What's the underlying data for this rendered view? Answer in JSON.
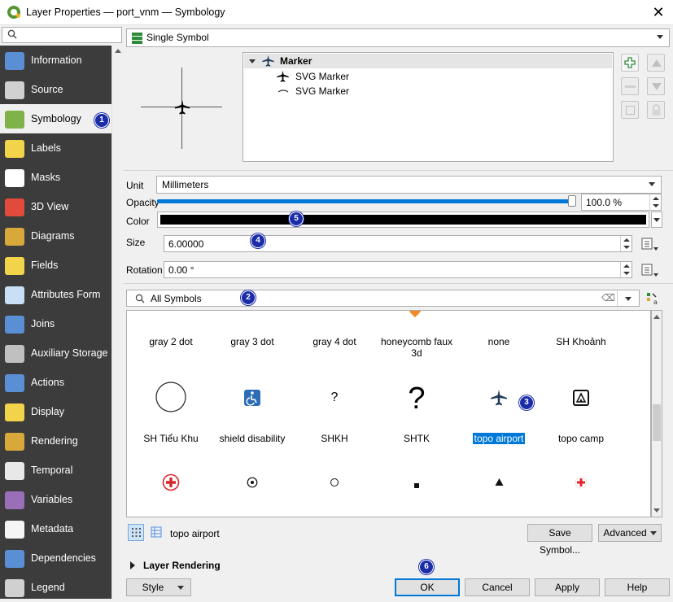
{
  "window": {
    "title": "Layer Properties — port_vnm — Symbology",
    "close_glyph": "✕"
  },
  "sidebar": {
    "search_icon": "magnifier-icon",
    "items": [
      {
        "label": "Information",
        "icon": "information-icon",
        "color": "#5a8fd6"
      },
      {
        "label": "Source",
        "icon": "source-gear-icon",
        "color": "#d0d0d0"
      },
      {
        "label": "Symbology",
        "icon": "symbology-brush-icon",
        "color": "#7fb34a"
      },
      {
        "label": "Labels",
        "icon": "labels-abc-icon",
        "color": "#f2d44b"
      },
      {
        "label": "Masks",
        "icon": "masks-abc-icon",
        "color": "#ffffff"
      },
      {
        "label": "3D View",
        "icon": "cube-3d-icon",
        "color": "#e24b3b"
      },
      {
        "label": "Diagrams",
        "icon": "diagrams-icon",
        "color": "#d9a83a"
      },
      {
        "label": "Fields",
        "icon": "fields-icon",
        "color": "#f2d44b"
      },
      {
        "label": "Attributes Form",
        "icon": "attributes-form-icon",
        "color": "#c9dff5"
      },
      {
        "label": "Joins",
        "icon": "joins-icon",
        "color": "#5a8fd6"
      },
      {
        "label": "Auxiliary Storage",
        "icon": "auxiliary-storage-icon",
        "color": "#c0c0c0"
      },
      {
        "label": "Actions",
        "icon": "actions-gear-icon",
        "color": "#5a8fd6"
      },
      {
        "label": "Display",
        "icon": "display-speech-icon",
        "color": "#f2d44b"
      },
      {
        "label": "Rendering",
        "icon": "rendering-brush-icon",
        "color": "#d9a83a"
      },
      {
        "label": "Temporal",
        "icon": "temporal-clock-icon",
        "color": "#e8e8e8"
      },
      {
        "label": "Variables",
        "icon": "variables-icon",
        "color": "#9b6fb8"
      },
      {
        "label": "Metadata",
        "icon": "metadata-icon",
        "color": "#f5f5f5"
      },
      {
        "label": "Dependencies",
        "icon": "dependencies-icon",
        "color": "#5a8fd6"
      },
      {
        "label": "Legend",
        "icon": "legend-icon",
        "color": "#d0d0d0"
      }
    ],
    "active_index": 2
  },
  "renderer": {
    "selected": "Single Symbol",
    "icon": "single-symbol-icon"
  },
  "symbol_tree": {
    "root": "Marker",
    "layers": [
      "SVG Marker",
      "SVG Marker"
    ]
  },
  "unit": {
    "label": "Unit",
    "value": "Millimeters"
  },
  "opacity": {
    "label": "Opacity",
    "value": "100.0 %",
    "fraction": 1.0
  },
  "color": {
    "label": "Color",
    "value": "#000000"
  },
  "size": {
    "label": "Size",
    "value": "6.00000"
  },
  "rotation": {
    "label": "Rotation",
    "value": "0.00 °"
  },
  "symbol_search": {
    "value": "All Symbols",
    "clear_glyph": "⌫"
  },
  "symbols_row1": [
    {
      "name": "gray 2 dot"
    },
    {
      "name": "gray 3 dot"
    },
    {
      "name": "gray 4 dot"
    },
    {
      "name": "honeycomb faux 3d"
    },
    {
      "name": "none"
    },
    {
      "name": "SH Khoảnh"
    }
  ],
  "symbols_row2": [
    {
      "name": "SH Tiểu Khu",
      "icon": "circle-outline-icon"
    },
    {
      "name": "shield disability",
      "icon": "wheelchair-icon"
    },
    {
      "name": "SHKH",
      "icon": "question-small-icon",
      "glyph": "?"
    },
    {
      "name": "SHTK",
      "icon": "question-large-icon",
      "glyph": "?"
    },
    {
      "name": "topo airport",
      "icon": "airplane-icon",
      "selected": true
    },
    {
      "name": "topo camp",
      "icon": "tent-icon"
    }
  ],
  "symbols_row3_icons": [
    "red-cross-circle-icon",
    "dot-circle-icon",
    "small-circle-icon",
    "small-square-icon",
    "triangle-icon",
    "red-cross-icon"
  ],
  "selected_symbol_name": "topo airport",
  "buttons": {
    "save_symbol": "Save Symbol...",
    "advanced": "Advanced",
    "style": "Style",
    "ok": "OK",
    "cancel": "Cancel",
    "apply": "Apply",
    "help": "Help"
  },
  "layer_rendering": "Layer Rendering",
  "badges": [
    "1",
    "2",
    "3",
    "4",
    "5",
    "6"
  ],
  "accent": "#1b2ca8"
}
